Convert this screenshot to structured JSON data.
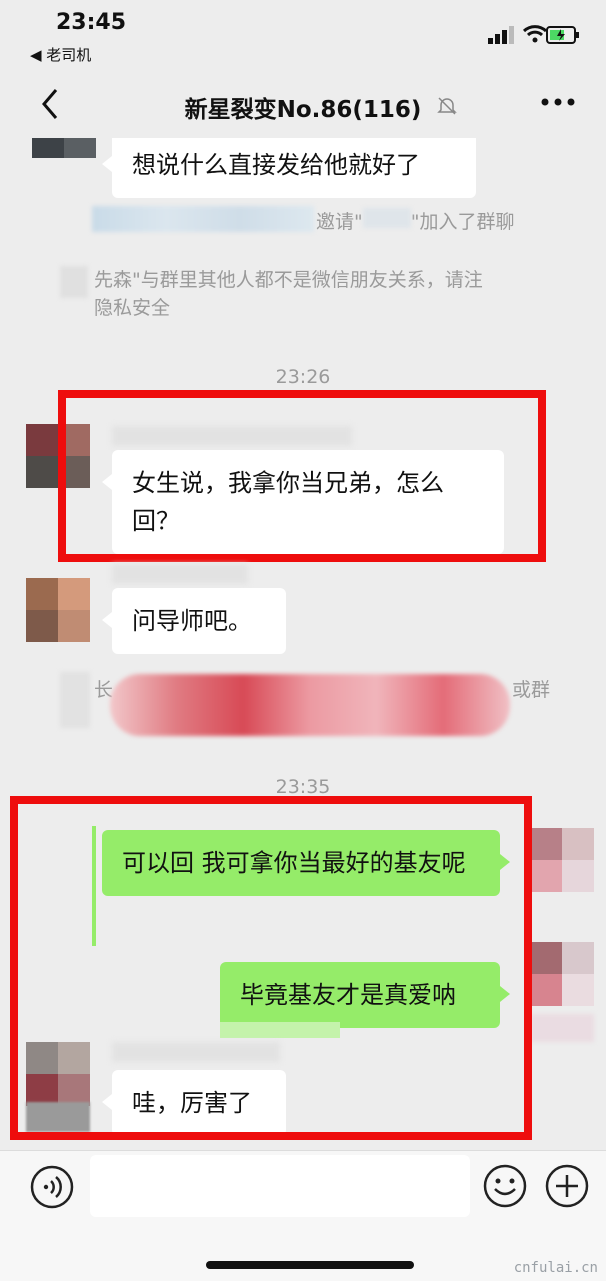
{
  "status_bar": {
    "time": "23:45",
    "back_app": "◀ 老司机"
  },
  "nav": {
    "title": "新星裂变No.86(116)"
  },
  "messages": {
    "m1": "想说什么直接发给他就好了",
    "sys1_invite": "邀请\"",
    "sys1_joined": "\"加入了群聊",
    "sys2_line1": "先森\"与群里其他人都不是微信朋友关系，请注",
    "sys2_line2": "隐私安全",
    "time1": "23:26",
    "m2": "女生说，我拿你当兄弟，怎么回？",
    "m3": "问导师吧。",
    "sys3_left_line1": "长",
    "sys3_right": "或群",
    "time2": "23:35",
    "m4": "可以回 我可拿你当最好的基友呢",
    "m5": "毕竟基友才是真爱呐",
    "m6": "哇，厉害了"
  },
  "watermark": "cnfulai.cn",
  "colors": {
    "accent_red": "#ee0d0d",
    "bubble_green": "#95ec69",
    "background": "#ededed"
  }
}
